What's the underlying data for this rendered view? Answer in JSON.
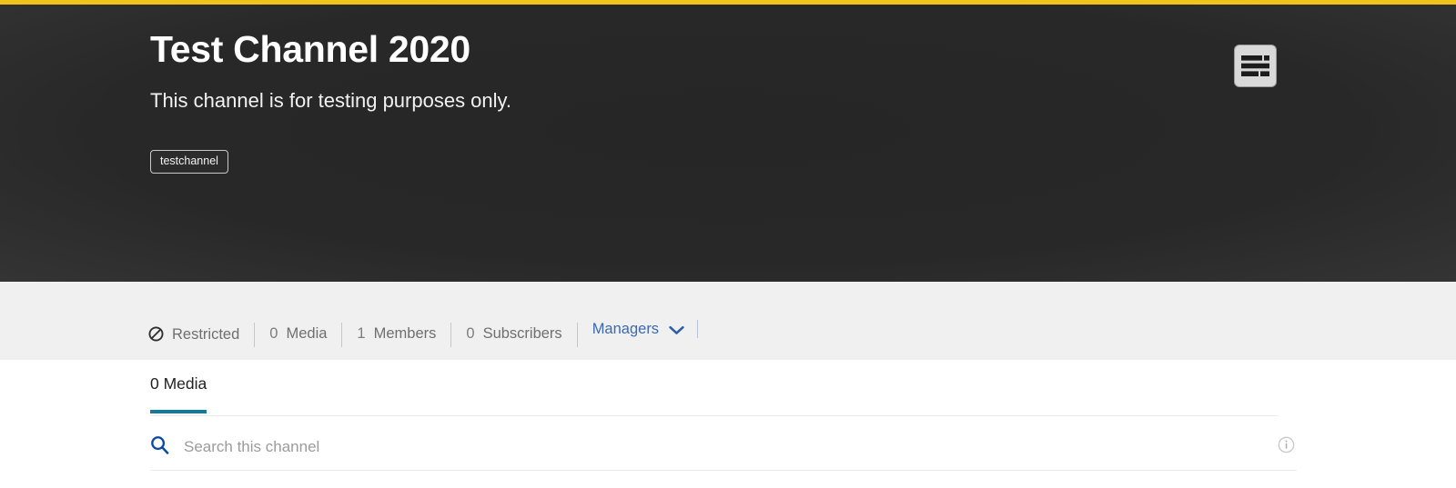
{
  "theme": {
    "accent_yellow": "#f0c419",
    "hero_bg": "#2c2c2c",
    "tab_underline": "#107b9e",
    "link_blue": "#3b6ab0",
    "search_icon_blue": "#0a4a9e",
    "stats_bar_bg": "#f0f0f0"
  },
  "hero": {
    "title": "Test Channel 2020",
    "description": "This channel is for testing purposes only.",
    "tags": [
      "testchannel"
    ],
    "action_icon": "list-view-icon"
  },
  "stats": {
    "restricted_icon": "restricted-icon",
    "items": [
      {
        "icon": "restricted-icon",
        "count": "",
        "label": "Restricted"
      },
      {
        "icon": "",
        "count": "0",
        "label": "Media"
      },
      {
        "icon": "",
        "count": "1",
        "label": "Members"
      },
      {
        "icon": "",
        "count": "0",
        "label": "Subscribers"
      }
    ],
    "managers": {
      "label": "Managers",
      "chevron_icon": "chevron-down-icon"
    }
  },
  "main": {
    "tabs": [
      {
        "label": "0 Media",
        "active": true
      }
    ],
    "search": {
      "icon": "search-icon",
      "value": "",
      "placeholder": "Search this channel",
      "info_icon": "info-icon"
    }
  }
}
